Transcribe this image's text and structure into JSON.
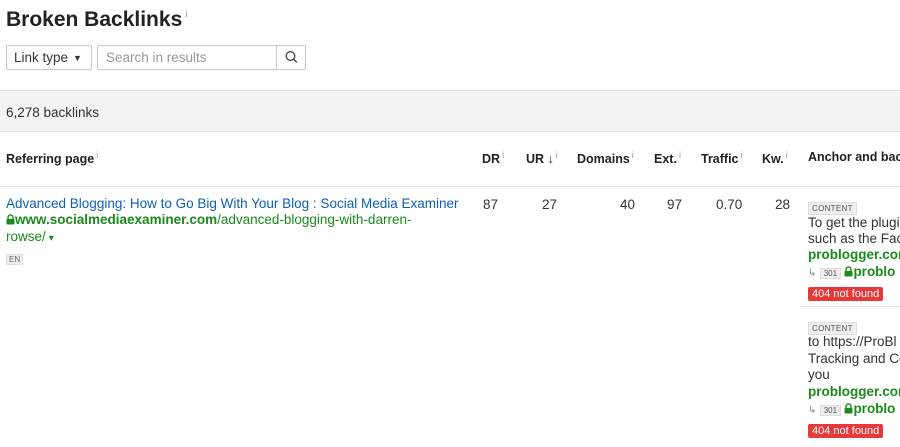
{
  "page": {
    "title": "Broken Backlinks",
    "title_info": "i"
  },
  "toolbar": {
    "link_type_label": "Link type",
    "link_type_caret": "▼",
    "search_placeholder": "Search in results",
    "search_icon": "search-icon"
  },
  "summary": {
    "backlinks_count": "6,278 backlinks"
  },
  "columns": {
    "referring_page": "Referring page",
    "dr": "DR",
    "ur": "UR",
    "ur_sort": "↓",
    "domains": "Domains",
    "ext": "Ext.",
    "traffic": "Traffic",
    "kw": "Kw.",
    "anchor": "Anchor and bac",
    "info": "i"
  },
  "rows": [
    {
      "title": "Advanced Blogging: How to Go Big With Your Blog : Social Media Examiner",
      "url_domain": "www.socialmediaexaminer.com",
      "url_path_1": "/advanced-blogging-with-darren-",
      "url_path_2": "rowse/",
      "url_caret": "▾",
      "lang": "EN",
      "dr": "87",
      "ur": "27",
      "domains": "40",
      "ext": "97",
      "traffic": "0.70",
      "kw": "28",
      "anchors": [
        {
          "tag": "CONTENT",
          "line1": "To get the plugi",
          "line2": "such as the Fac",
          "domain": "problogger.com",
          "redirect_arrow": "↳",
          "redirect_code": "301",
          "redirect_domain": "problo",
          "status": "404 not found"
        },
        {
          "tag": "CONTENT",
          "line1": "to https://ProBl",
          "line2_link": "Tracking and Co",
          "line3": "you",
          "domain": "problogger.com",
          "redirect_arrow": "↳",
          "redirect_code": "301",
          "redirect_domain": "problo",
          "status": "404 not found"
        }
      ]
    }
  ],
  "colors": {
    "link_blue": "#0f5fb5",
    "url_green": "#1a8a1a",
    "error_red": "#e5393a",
    "summary_bg": "#f3f3f3"
  }
}
